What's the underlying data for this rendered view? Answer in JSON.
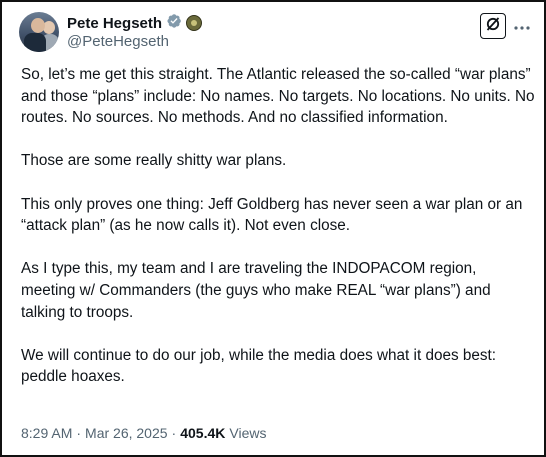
{
  "author": {
    "display_name": "Pete Hegseth",
    "handle": "@PeteHegseth"
  },
  "icons": {
    "verified": "verified-badge-icon",
    "affiliation": "department-of-defense-seal-icon",
    "grok": "grok-icon",
    "more": "more-options-icon"
  },
  "colors": {
    "verified_badge": "#829aab",
    "secondary_text": "#536471",
    "primary_text": "#0f1419"
  },
  "post": {
    "paragraphs": [
      "So, let’s me get this straight. The Atlantic released the so-called “war plans” and those “plans” include: No names. No targets. No locations. No units. No routes. No sources. No methods. And no classified information.",
      "Those are some really shitty war plans.",
      "This only proves one thing: Jeff Goldberg has never seen a war plan or an “attack plan” (as he now calls it). Not even close.",
      "As I type this, my team and I are traveling the INDOPACOM region, meeting w/ Commanders (the guys who make REAL “war plans”) and talking to troops.",
      "We will continue to do our job, while the media does what it does best: peddle hoaxes."
    ]
  },
  "meta": {
    "time": "8:29 AM",
    "separator": "·",
    "date": "Mar 26, 2025",
    "separator2": "·",
    "views_count": "405.4K",
    "views_label": "Views"
  }
}
